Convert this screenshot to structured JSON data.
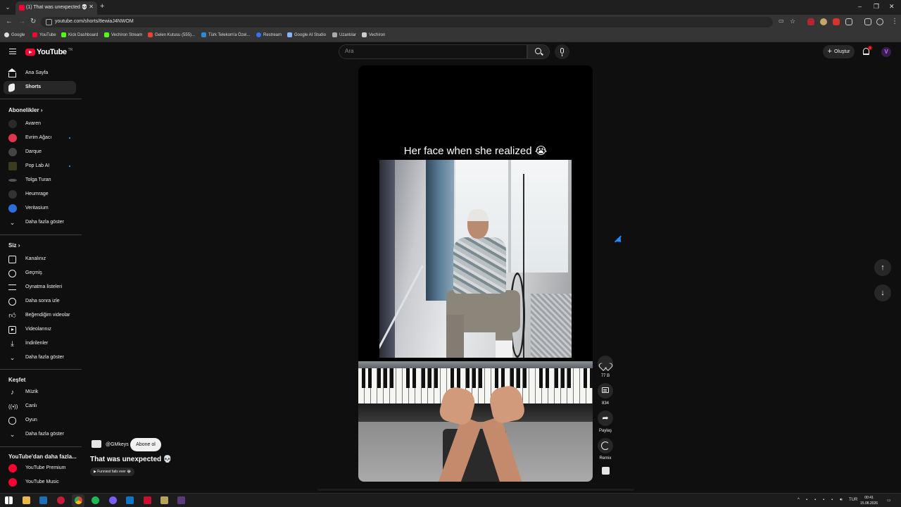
{
  "browser": {
    "tab_title": "(1) That was unexpected 💀",
    "url": "youtube.com/shorts/8ewiaJ4NWOM",
    "bookmarks": [
      "Google",
      "YouTube",
      "Kick Dashboard",
      "Vechiron Stream",
      "Gelen Kutusu (555)...",
      "Türk Telekom'a Özel...",
      "Restream",
      "Google AI Studio",
      "Uzantılar",
      "Vechiron"
    ],
    "window_controls": [
      "–",
      "❐",
      "✕"
    ]
  },
  "header": {
    "logo": "YouTube",
    "logo_suffix": "TR",
    "search_placeholder": "Ara",
    "create_label": "Oluştur",
    "notification_count": "1",
    "avatar_initial": "V"
  },
  "sidebar": {
    "main": [
      {
        "label": "Ana Sayfa",
        "icon": "home-icon"
      },
      {
        "label": "Shorts",
        "icon": "shorts-icon"
      }
    ],
    "subscriptions_heading": "Abonelikler",
    "subscriptions": [
      {
        "label": "Avaren",
        "color": "#2a2a2a",
        "dot": false
      },
      {
        "label": "Evrim Ağacı",
        "color": "#e0364d",
        "dot": true
      },
      {
        "label": "Darque",
        "color": "#444444",
        "dot": false
      },
      {
        "label": "Pop Lab AI",
        "color": "#3b3b1f",
        "dot": true
      },
      {
        "label": "Tolga Turan",
        "color": "#555555",
        "dot": false
      },
      {
        "label": "Heumrage",
        "color": "#333333",
        "dot": false
      },
      {
        "label": "Veritasium",
        "color": "#2d6fd6",
        "dot": false
      }
    ],
    "subs_more": "Daha fazla göster",
    "you_heading": "Siz",
    "you": [
      {
        "label": "Kanalınız",
        "icon": "channel-icon"
      },
      {
        "label": "Geçmiş",
        "icon": "history-icon"
      },
      {
        "label": "Oynatma listeleri",
        "icon": "playlists-icon"
      },
      {
        "label": "Daha sonra izle",
        "icon": "watch-later-icon"
      },
      {
        "label": "Beğendiğim videolar",
        "icon": "liked-icon"
      },
      {
        "label": "Videolarınız",
        "icon": "your-videos-icon"
      },
      {
        "label": "İndirilenler",
        "icon": "downloads-icon"
      }
    ],
    "you_more": "Daha fazla göster",
    "explore_heading": "Keşfet",
    "explore": [
      {
        "label": "Müzik",
        "icon": "music-icon"
      },
      {
        "label": "Canlı",
        "icon": "live-icon"
      },
      {
        "label": "Oyun",
        "icon": "gaming-icon"
      }
    ],
    "explore_more": "Daha fazla göster",
    "more_heading": "YouTube'dan daha fazla...",
    "more": [
      {
        "label": "YouTube Premium"
      },
      {
        "label": "YouTube Music"
      }
    ]
  },
  "short": {
    "caption": "Her face when she realized 😭",
    "channel_handle": "@GMkeys",
    "subscribe_label": "Abone ol",
    "title": "That was unexpected 💀",
    "playlist_pill": "▶ Funniest fails ever 😂",
    "likes": "77 B",
    "comments": "834",
    "share_label": "Paylaş",
    "remix_label": "Remix"
  },
  "navigation": {
    "up": "↑",
    "down": "↓"
  },
  "taskbar": {
    "lang": "TUR",
    "time": "00:41",
    "date": "15.08.2026"
  },
  "colors": {
    "brand_red": "#ff0033",
    "background": "#0f0f0f",
    "chip": "#272727"
  }
}
